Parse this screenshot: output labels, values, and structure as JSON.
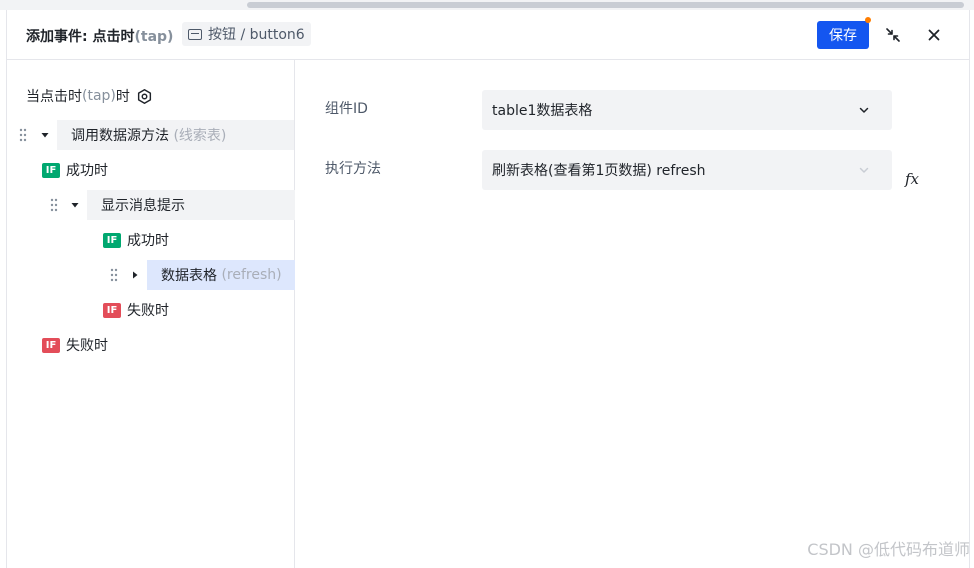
{
  "header": {
    "title_prefix": "添加事件: 点击时",
    "title_tap": "(tap)",
    "component_label": "按钮 / button6",
    "save_label": "保存"
  },
  "tree": {
    "root_label": "当点击时",
    "root_tap": "(tap)",
    "root_suffix": "时",
    "items": [
      {
        "label": "调用数据源方法",
        "hint": "(线索表)"
      },
      {
        "badge": "IF",
        "label": "成功时"
      },
      {
        "label": "显示消息提示"
      },
      {
        "badge": "IF",
        "label": "成功时"
      },
      {
        "label": "数据表格",
        "hint": "(refresh)"
      },
      {
        "badge": "IF",
        "label": "失败时"
      },
      {
        "badge": "IF",
        "label": "失败时"
      }
    ]
  },
  "form": {
    "component_id_label": "组件ID",
    "component_id_value": "table1数据表格",
    "method_label": "执行方法",
    "method_value": "刷新表格(查看第1页数据) refresh",
    "fx_label": "fx"
  },
  "watermark": "CSDN @低代码布道师",
  "colors": {
    "primary": "#1456f0",
    "success_badge": "#00a870",
    "fail_badge": "#e34d59",
    "selected_bg": "#dde7fd",
    "notify_dot": "#ff7d00"
  }
}
